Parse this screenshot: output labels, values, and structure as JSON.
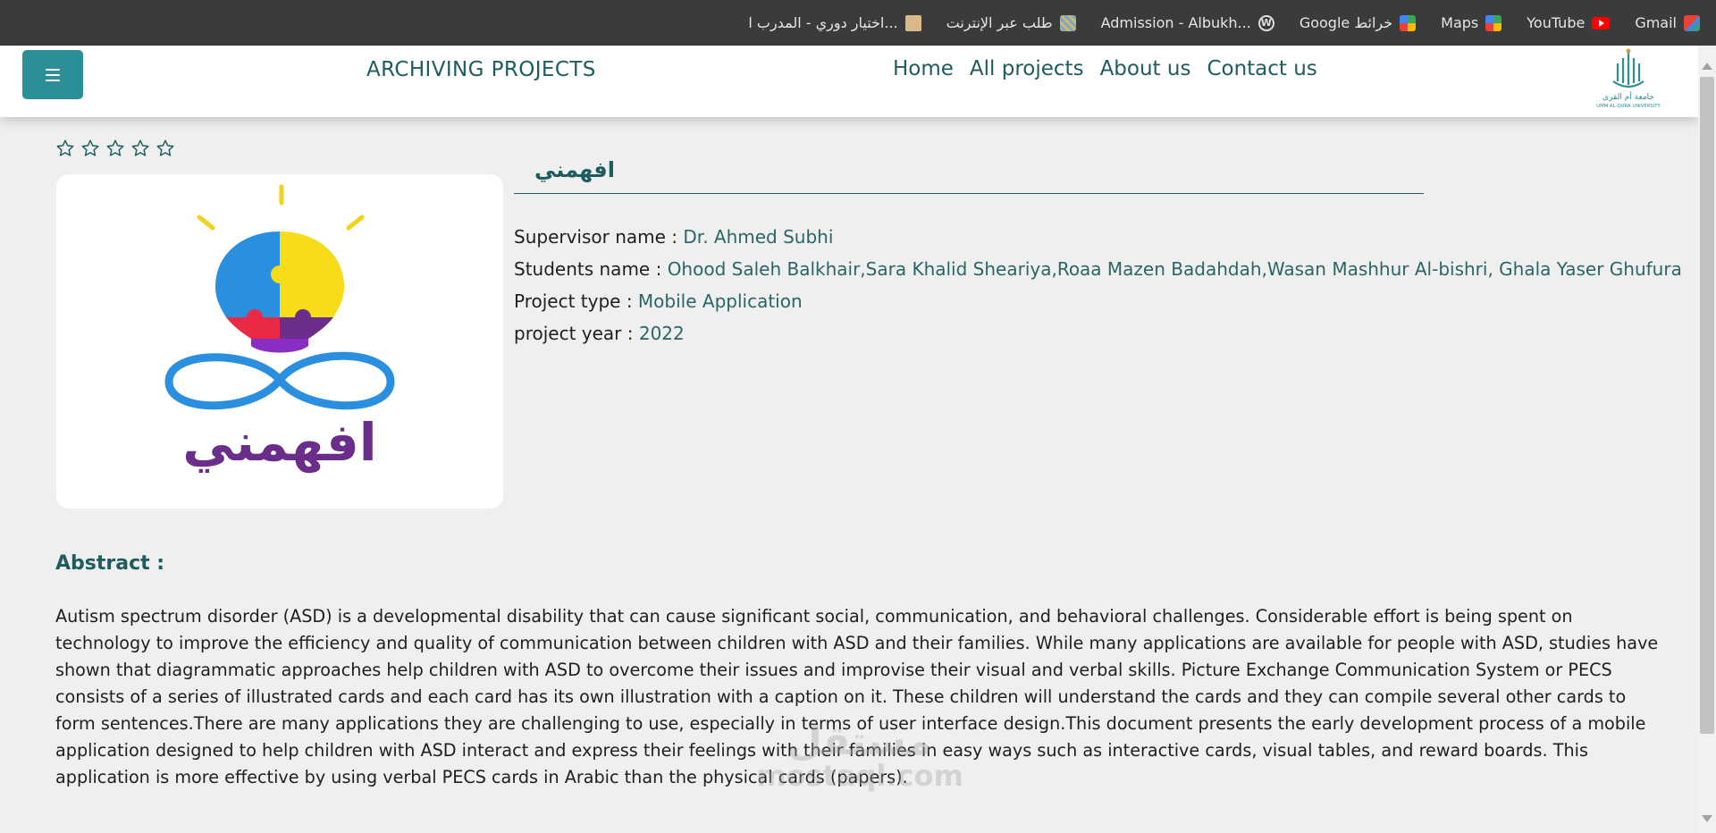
{
  "bookmarks": [
    {
      "label": "Gmail",
      "icon": "gmail-icon"
    },
    {
      "label": "YouTube",
      "icon": "youtube-icon"
    },
    {
      "label": "Maps",
      "icon": "maps-icon"
    },
    {
      "label": "Google خرائط",
      "icon": "maps-icon"
    },
    {
      "label": "Admission - Albukh...",
      "icon": "wordpress-icon"
    },
    {
      "label": "طلب عبر الإنترنت",
      "icon": "document-icon"
    },
    {
      "label": "اختيار دوري - المدرب ا...",
      "icon": "avatar-icon"
    }
  ],
  "header": {
    "brand": "ARCHIVING PROJECTS",
    "nav": [
      "Home",
      "All projects",
      "About us",
      "Contact us"
    ],
    "logo_text_ar": "جامعة أم القرى",
    "logo_text_en": "UMM AL-QURA UNIVERSITY"
  },
  "project": {
    "rating": 0,
    "rating_max": 5,
    "title": "افهمني",
    "poster_text": "افهمني",
    "supervisor_label": "Supervisor name :",
    "supervisor": "Dr. Ahmed Subhi",
    "students_label": "Students name :",
    "students": "Ohood Saleh Balkhair,Sara Khalid Sheariya,Roaa Mazen Badahdah,Wasan Mashhur Al-bishri, Ghala Yaser Ghufura",
    "type_label": "Project type :",
    "type": "Mobile Application",
    "year_label": "project year :",
    "year": "2022"
  },
  "abstract": {
    "title": "Abstract :",
    "text": "Autism spectrum disorder (ASD) is a developmental disability that can cause significant social, communication, and behavioral challenges. Considerable effort is being spent on technology to improve the efficiency and quality of communication between children with ASD and their families. While many applications are available for people with ASD, studies have shown that diagrammatic approaches help children with ASD to overcome their issues and improvise their visual and verbal skills. Picture Exchange Communication System or PECS consists of a series of illustrated cards and each card has its own illustration with a caption on it. These children will understand the cards and they can compile several other cards to form sentences.There are many applications they are challenging to use, especially in terms of user interface design.This document presents the early development process of a mobile application designed to help children with ASD interact and express their feelings with their families in easy ways such as interactive cards, visual tables, and reward boards. This application is more effective by using verbal PECS cards in Arabic than the physical cards (papers)."
  },
  "watermark": {
    "ar": "مستقل",
    "en": "mostaql.com"
  },
  "colors": {
    "accent": "#2c8f97",
    "brand_text": "#1e5c5f",
    "bookmarks_bg": "#3b3b3b"
  }
}
